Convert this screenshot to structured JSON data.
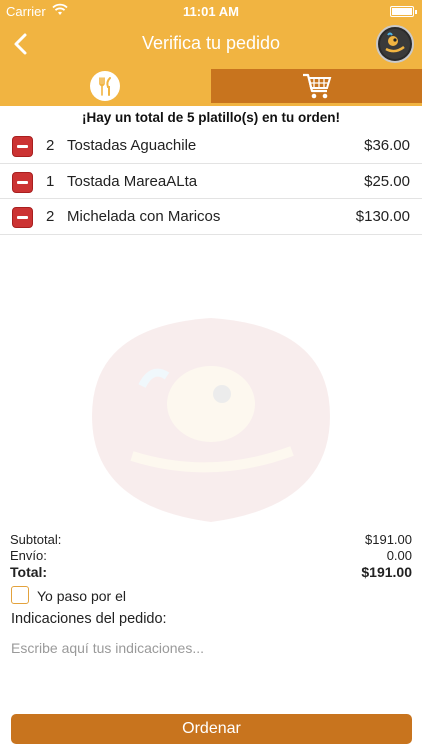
{
  "status_bar": {
    "carrier": "Carrier",
    "time": "11:01 AM"
  },
  "nav": {
    "title": "Verifica tu pedido",
    "logo_icon": "restaurant-logo"
  },
  "tabs": [
    {
      "name": "menu",
      "icon": "fork-knife-icon"
    },
    {
      "name": "cart",
      "icon": "shopping-cart-icon",
      "selected": true
    }
  ],
  "summary": "¡Hay un total de 5 platillo(s) en tu orden!",
  "order_items": [
    {
      "qty": "2",
      "name": "Tostadas Aguachile",
      "price": "$36.00"
    },
    {
      "qty": "1",
      "name": "Tostada MareaALta",
      "price": "$25.00"
    },
    {
      "qty": "2",
      "name": "Michelada con Maricos",
      "price": "$130.00"
    }
  ],
  "totals": {
    "subtotal_label": "Subtotal:",
    "subtotal_value": "$191.00",
    "envio_label": "Envío:",
    "envio_value": "0.00",
    "total_label": "Total:",
    "total_value": "$191.00"
  },
  "pickup": {
    "label": "Yo paso por el",
    "checked": false
  },
  "indications": {
    "label": "Indicaciones del pedido:",
    "placeholder": "Escribe aquí tus indicaciones...",
    "value": ""
  },
  "order_button": "Ordenar",
  "colors": {
    "accent": "#f1b441",
    "dark_accent": "#c8741e",
    "remove": "#cc3333"
  }
}
